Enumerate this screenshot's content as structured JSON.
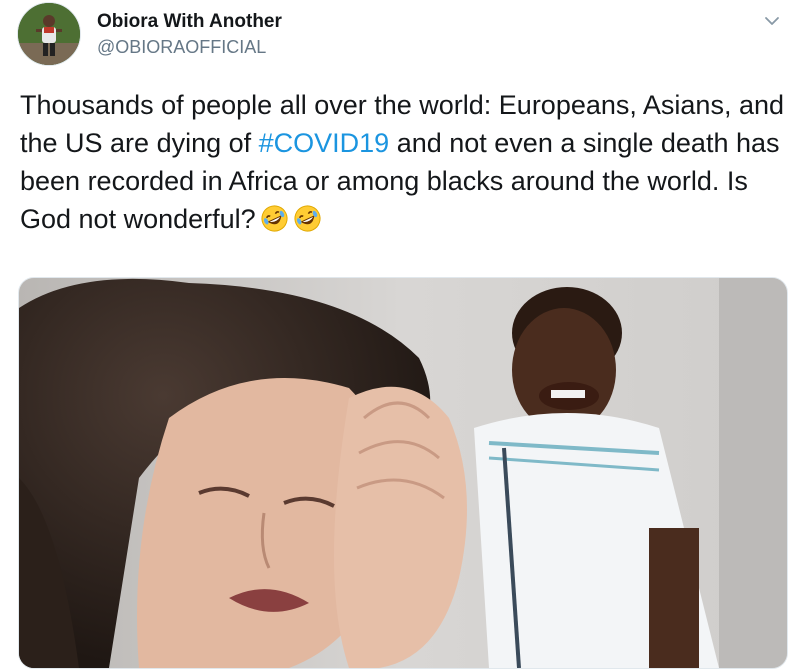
{
  "author": {
    "display_name": "Obiora With Another",
    "handle": "@OBIORAOFFICIAL",
    "avatar_icon": "person-avatar"
  },
  "tweet": {
    "text_before": "Thousands of people all over the world: Europeans, Asians, and the US are dying of ",
    "hashtag": "#COVID19",
    "text_after": " and not even a single death has been recorded in Africa or among blacks around the world. Is God not wonderful?",
    "emojis": [
      "rolling-on-floor-laughing-emoji",
      "rolling-on-floor-laughing-emoji"
    ]
  },
  "menu": {
    "icon": "chevron-down-icon"
  },
  "media": {
    "type": "gif-thumbnail"
  },
  "colors": {
    "text": "#14171a",
    "secondary": "#657786",
    "link": "#1b95e0",
    "emoji": "#ffcc33"
  }
}
